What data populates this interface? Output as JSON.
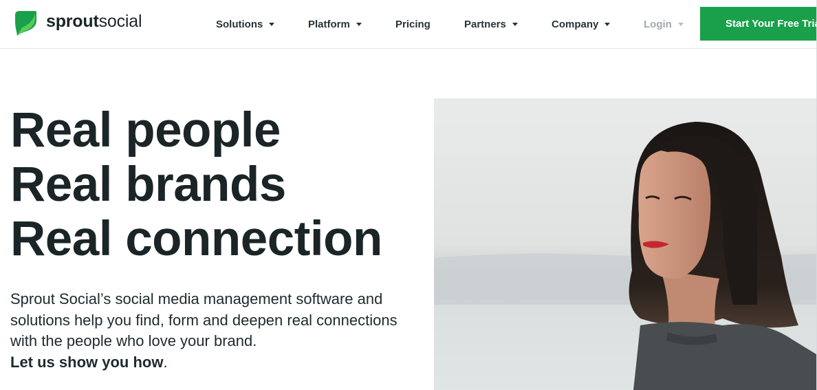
{
  "brand": {
    "name_bold": "sprout",
    "name_regular": "social",
    "logo_icon": "sprout-leaf-icon",
    "accent_color": "#1aa04b"
  },
  "nav": {
    "items": [
      {
        "label": "Solutions",
        "has_dropdown": true
      },
      {
        "label": "Platform",
        "has_dropdown": true
      },
      {
        "label": "Pricing",
        "has_dropdown": false
      },
      {
        "label": "Partners",
        "has_dropdown": true
      },
      {
        "label": "Company",
        "has_dropdown": true
      },
      {
        "label": "Login",
        "has_dropdown": true
      }
    ],
    "cta_label": "Start Your Free Trial"
  },
  "hero": {
    "headline": [
      "Real people",
      "Real brands",
      "Real connection"
    ],
    "description": "Sprout Social’s social media management software and solutions help you find, form and deepen real connections with the people who love your brand.",
    "cta_text": "Let us show you how",
    "cta_suffix": "."
  }
}
